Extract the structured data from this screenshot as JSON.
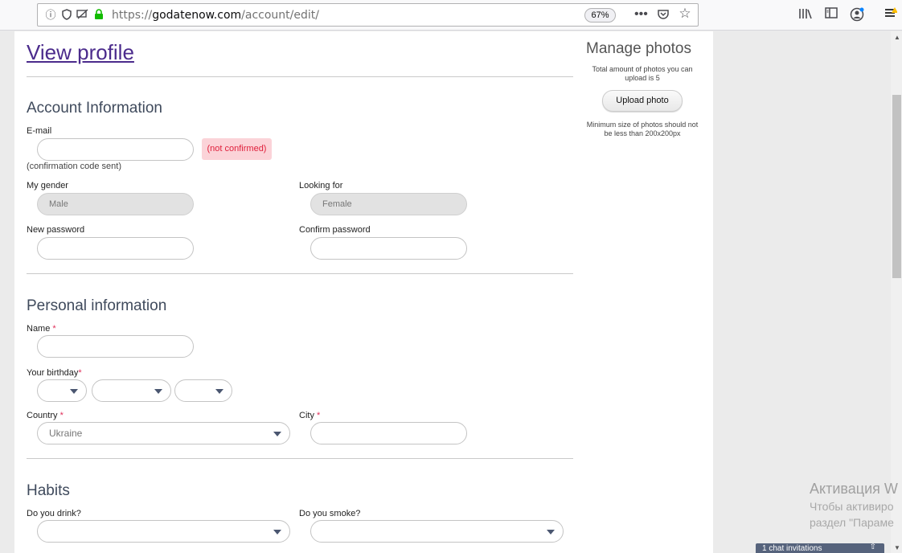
{
  "browser": {
    "url_prefix": "https://",
    "url_domain": "godatenow.com",
    "url_path": "/account/edit/",
    "zoom": "67%",
    "icons": [
      "info-icon",
      "shield-icon",
      "permissions-icon",
      "lock-icon",
      "more-icon",
      "pocket-icon",
      "bookmark-star-icon",
      "library-icon",
      "sidebar-icon",
      "account-icon",
      "menu-icon"
    ]
  },
  "page": {
    "view_profile": "View profile",
    "account": {
      "title": "Account Information",
      "email_label": "E-mail",
      "email_value": "",
      "not_confirmed": "(not confirmed)",
      "confirmation_note": "(confirmation code sent)",
      "gender_label": "My gender",
      "gender_value": "Male",
      "looking_for_label": "Looking for",
      "looking_for_value": "Female",
      "new_password_label": "New password",
      "confirm_password_label": "Confirm password"
    },
    "personal": {
      "title": "Personal information",
      "name_label": "Name",
      "birthday_label": "Your birthday",
      "country_label": "Country",
      "country_value": "Ukraine",
      "city_label": "City",
      "required_mark": "*"
    },
    "habits": {
      "title": "Habits",
      "drink_label": "Do you drink?",
      "smoke_label": "Do you smoke?"
    }
  },
  "sidebar": {
    "title": "Manage photos",
    "total_text": "Total amount of photos you can upload is 5",
    "upload_button": "Upload photo",
    "min_size_text": "Minimum size of photos should not be less than 200x200px"
  },
  "overlay": {
    "activation_title": "Активация W",
    "activation_line1": "Чтобы активиро",
    "activation_line2": "раздел \"Параме",
    "chat_bar": "1 chat invitations"
  },
  "colors": {
    "accent_link": "#4b2b8c",
    "badge_bg": "#fbd3d8",
    "badge_text": "#e0203c",
    "required": "#e0305a"
  }
}
